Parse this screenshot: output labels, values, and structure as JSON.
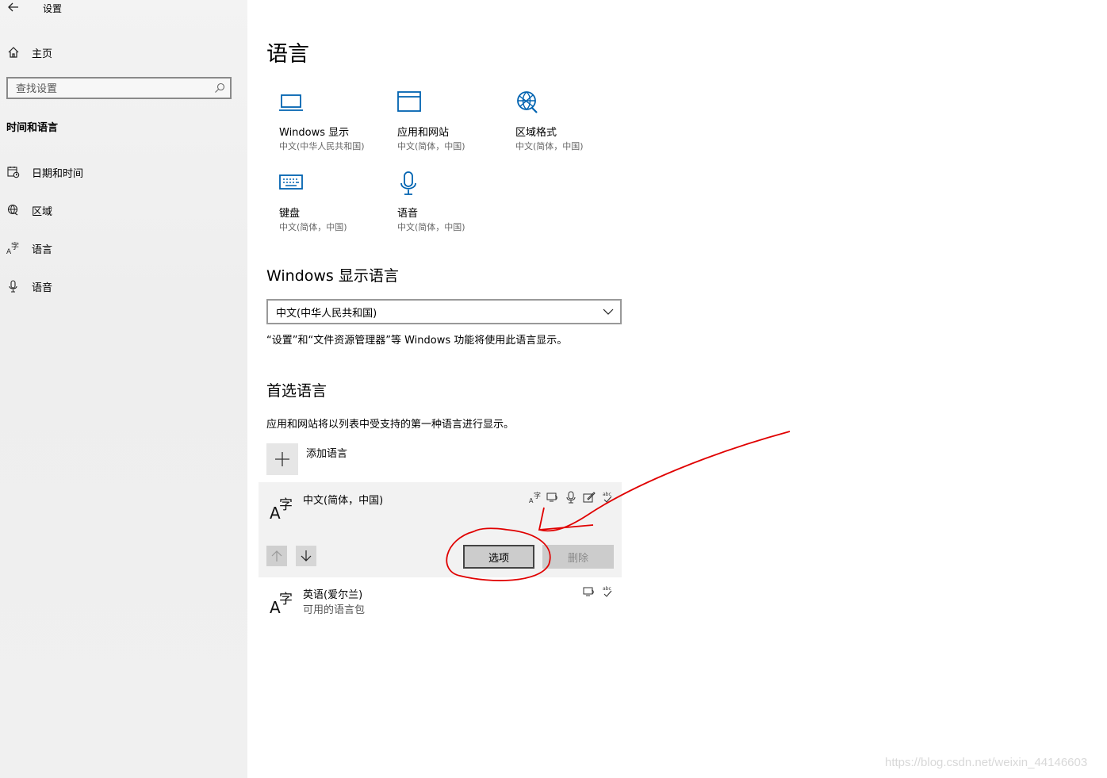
{
  "window": {
    "title": "设置"
  },
  "sidebar": {
    "home_label": "主页",
    "search_placeholder": "查找设置",
    "section_title": "时间和语言",
    "items": [
      {
        "label": "日期和时间",
        "icon": "calendar-clock-icon"
      },
      {
        "label": "区域",
        "icon": "globe-icon"
      },
      {
        "label": "语言",
        "icon": "language-icon"
      },
      {
        "label": "语音",
        "icon": "microphone-icon"
      }
    ]
  },
  "main": {
    "title": "语言",
    "tiles": [
      {
        "name": "Windows 显示",
        "sub": "中文(中华人民共和国)",
        "icon": "laptop-icon"
      },
      {
        "name": "应用和网站",
        "sub": "中文(简体，中国)",
        "icon": "window-icon"
      },
      {
        "name": "区域格式",
        "sub": "中文(简体，中国)",
        "icon": "globe-icon"
      },
      {
        "name": "键盘",
        "sub": "中文(简体，中国)",
        "icon": "keyboard-icon"
      },
      {
        "name": "语音",
        "sub": "中文(简体，中国)",
        "icon": "microphone-icon"
      }
    ],
    "display_language": {
      "heading": "Windows 显示语言",
      "selected": "中文(中华人民共和国)",
      "note": "“设置”和“文件资源管理器”等 Windows 功能将使用此语言显示。"
    },
    "preferred": {
      "heading": "首选语言",
      "note": "应用和网站将以列表中受支持的第一种语言进行显示。",
      "add_label": "添加语言",
      "languages": [
        {
          "name": "中文(简体，中国)",
          "sub": "",
          "features": [
            "display-language-icon",
            "text-to-speech-icon",
            "speech-recognition-icon",
            "handwriting-icon",
            "spellcheck-icon"
          ]
        },
        {
          "name": "英语(爱尔兰)",
          "sub": "可用的语言包",
          "features": [
            "text-to-speech-icon",
            "spellcheck-icon"
          ]
        }
      ],
      "options_label": "选项",
      "remove_label": "删除"
    }
  },
  "watermark": "https://blog.csdn.net/weixin_44146603",
  "colors": {
    "accent": "#0063b1",
    "annotation": "#e00000"
  }
}
